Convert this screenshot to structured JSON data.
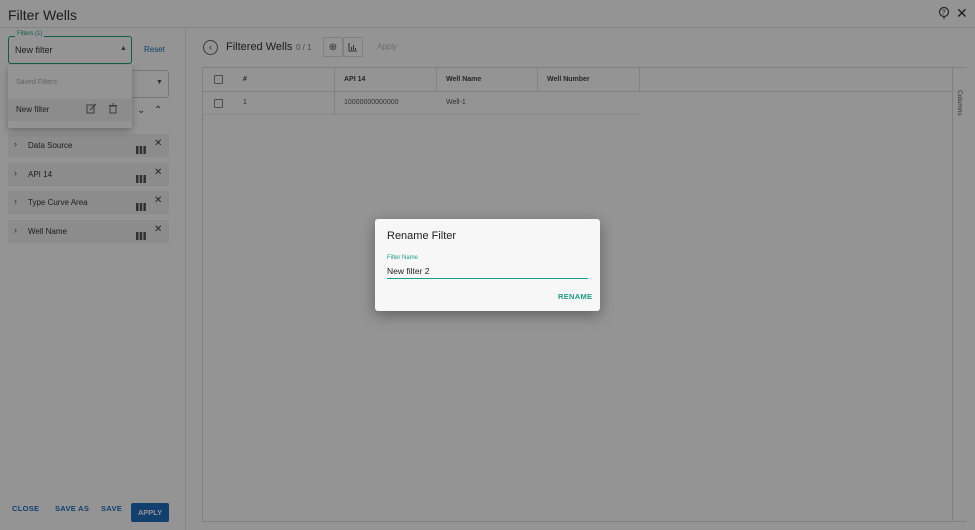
{
  "window": {
    "title": "Filter Wells"
  },
  "left_panel": {
    "filters_legend": "Filters (1)",
    "filters_value": "New filter",
    "reset_label": "Reset",
    "saved_filters_header": "Saved Filters",
    "saved_filters": [
      {
        "label": "New filter"
      }
    ],
    "filter_rows": [
      {
        "label": "Data Source"
      },
      {
        "label": "API 14"
      },
      {
        "label": "Type Curve Area"
      },
      {
        "label": "Well Name"
      }
    ],
    "footer": {
      "close": "CLOSE",
      "save_as": "SAVE AS",
      "save": "SAVE",
      "apply": "APPLY"
    }
  },
  "main": {
    "title": "Filtered Wells",
    "count": "0 / 1",
    "apply_label": "Apply",
    "columns_label": "Columns",
    "table": {
      "headers": [
        "#",
        "API 14",
        "Well Name",
        "Well Number"
      ],
      "rows": [
        {
          "index": "1",
          "api14": "10000000000000",
          "well_name": "Well-1",
          "well_number": ""
        }
      ]
    }
  },
  "dialog": {
    "title": "Rename Filter",
    "field_label": "Filter Name",
    "field_value": "New filter 2",
    "rename_button": "RENAME"
  },
  "colors": {
    "accent": "#1e9e86",
    "primary": "#1e6fbf",
    "overlay": "rgba(0,0,0,0.42)"
  }
}
